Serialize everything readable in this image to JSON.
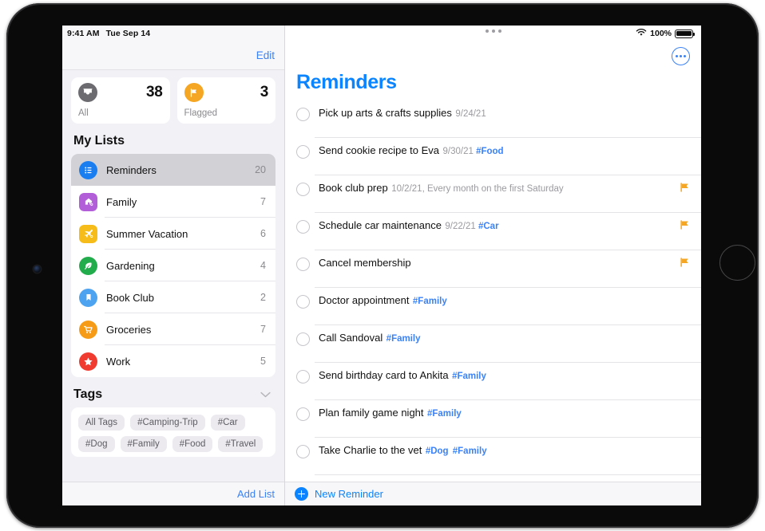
{
  "status_bar": {
    "time": "9:41 AM",
    "date": "Tue Sep 14",
    "wifi_icon": "wifi-icon",
    "battery_percent": "100%",
    "battery_icon": "battery-full-icon"
  },
  "sidebar": {
    "edit_label": "Edit",
    "smart_lists": [
      {
        "label": "All",
        "count": "38",
        "icon": "inbox-tray-icon",
        "color": "#6b6b70"
      },
      {
        "label": "Flagged",
        "count": "3",
        "icon": "flag-icon",
        "color": "#f5a623"
      }
    ],
    "my_lists_title": "My Lists",
    "lists": [
      {
        "label": "Reminders",
        "count": "20",
        "icon": "bulleted-list-icon",
        "color": "#1a7ef0",
        "shape": "circle",
        "selected": true
      },
      {
        "label": "Family",
        "count": "7",
        "icon": "house-icon",
        "color": "#b15ed8",
        "shape": "rounded",
        "selected": false
      },
      {
        "label": "Summer Vacation",
        "count": "6",
        "icon": "airplane-icon",
        "color": "#f5bc1a",
        "shape": "rounded",
        "selected": false
      },
      {
        "label": "Gardening",
        "count": "4",
        "icon": "leaf-icon",
        "color": "#23ac4b",
        "shape": "circle",
        "selected": false
      },
      {
        "label": "Book Club",
        "count": "2",
        "icon": "bookmark-icon",
        "color": "#4da3ef",
        "shape": "circle",
        "selected": false
      },
      {
        "label": "Groceries",
        "count": "7",
        "icon": "shopping-cart-icon",
        "color": "#f59b18",
        "shape": "circle",
        "selected": false
      },
      {
        "label": "Work",
        "count": "5",
        "icon": "star-icon",
        "color": "#ef3b30",
        "shape": "circle",
        "selected": false
      }
    ],
    "tags_title": "Tags",
    "tags_collapse_icon": "chevron-down-icon",
    "tags": [
      "All Tags",
      "#Camping-Trip",
      "#Car",
      "#Dog",
      "#Family",
      "#Food",
      "#Travel"
    ],
    "add_list_label": "Add List"
  },
  "detail": {
    "drag_handle_icon": "multitasking-handle-icon",
    "more_button_icon": "ellipsis-circle-icon",
    "title": "Reminders",
    "reminders": [
      {
        "title": "Pick up arts & crafts supplies",
        "date": "9/24/21",
        "detail": "",
        "tags": [],
        "flagged": false
      },
      {
        "title": "Send cookie recipe to Eva",
        "date": "9/30/21",
        "detail": "",
        "tags": [
          "#Food"
        ],
        "flagged": false
      },
      {
        "title": "Book club prep",
        "date": "10/2/21",
        "detail": ", Every month on the first Saturday",
        "tags": [],
        "flagged": true
      },
      {
        "title": "Schedule car maintenance",
        "date": "9/22/21",
        "detail": "",
        "tags": [
          "#Car"
        ],
        "flagged": true
      },
      {
        "title": "Cancel membership",
        "date": "",
        "detail": "",
        "tags": [],
        "flagged": true
      },
      {
        "title": "Doctor appointment",
        "date": "",
        "detail": "",
        "tags": [
          "#Family"
        ],
        "flagged": false
      },
      {
        "title": "Call Sandoval",
        "date": "",
        "detail": "",
        "tags": [
          "#Family"
        ],
        "flagged": false
      },
      {
        "title": "Send birthday card to Ankita",
        "date": "",
        "detail": "",
        "tags": [
          "#Family"
        ],
        "flagged": false
      },
      {
        "title": "Plan family game night",
        "date": "",
        "detail": "",
        "tags": [
          "#Family"
        ],
        "flagged": false
      },
      {
        "title": "Take Charlie to the vet",
        "date": "",
        "detail": "",
        "tags": [
          "#Dog",
          "#Family"
        ],
        "flagged": false
      },
      {
        "title": "",
        "date": "",
        "detail": "",
        "tags": [],
        "flagged": false,
        "partial": true
      }
    ],
    "new_reminder_label": "New Reminder",
    "new_reminder_icon": "plus-circle-icon"
  },
  "colors": {
    "accent_blue": "#0a84ff",
    "link_blue": "#3b82f6",
    "flag_orange": "#f5a623",
    "sidebar_bg": "#f2f1f6"
  }
}
